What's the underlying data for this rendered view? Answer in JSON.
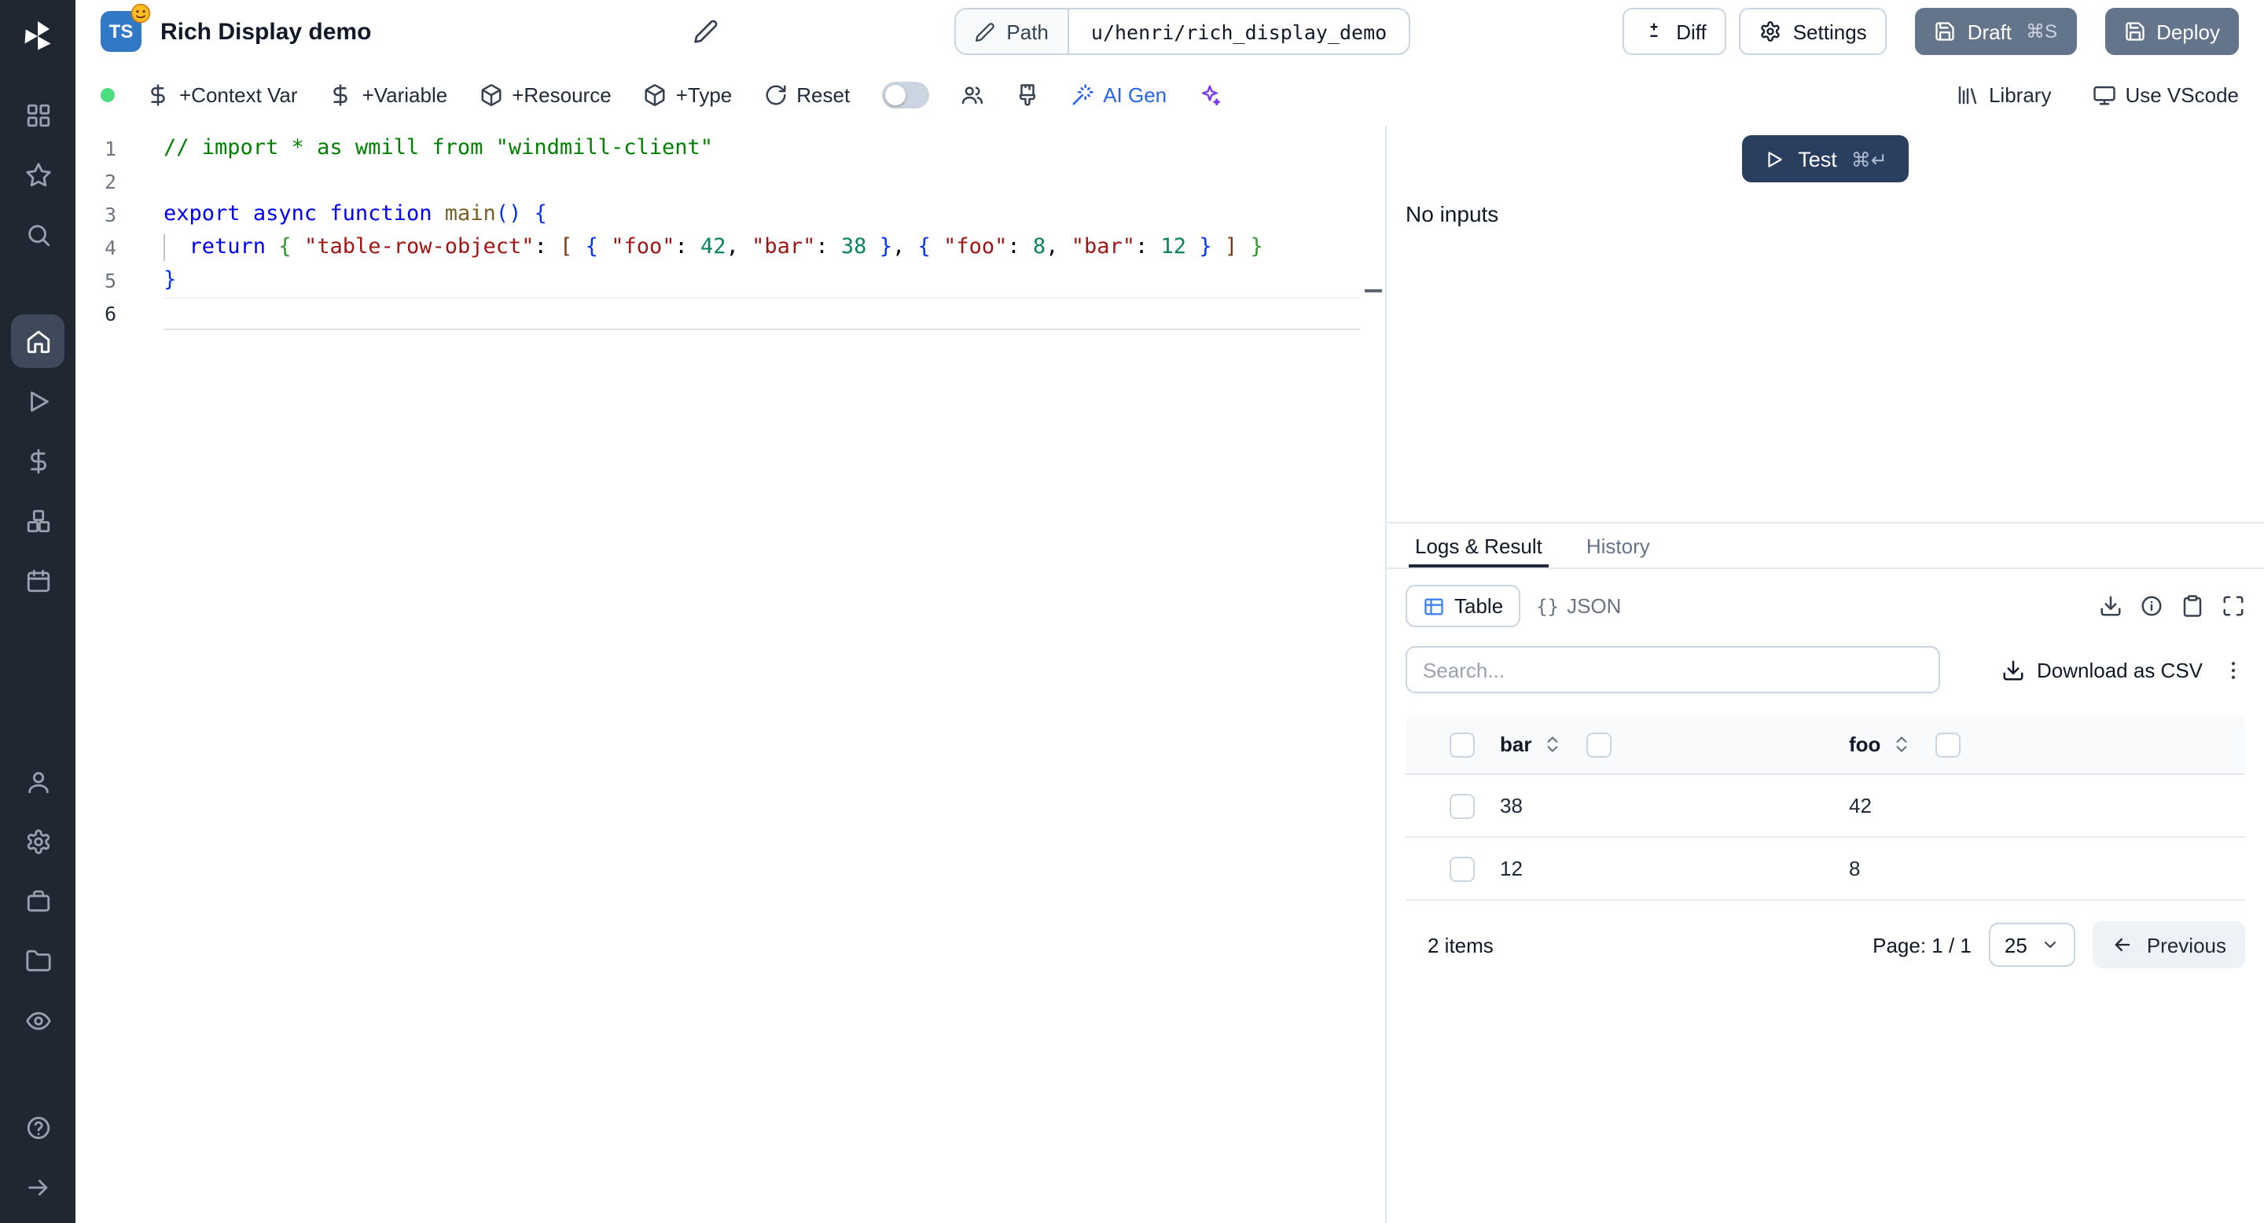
{
  "header": {
    "badge": "TS",
    "title": "Rich Display demo",
    "path_label": "Path",
    "path_value": "u/henri/rich_display_demo",
    "diff": "Diff",
    "settings": "Settings",
    "draft": "Draft",
    "draft_shortcut": "⌘S",
    "deploy": "Deploy"
  },
  "toolbar": {
    "context_var": "+Context Var",
    "variable": "+Variable",
    "resource": "+Resource",
    "type": "+Type",
    "reset": "Reset",
    "ai_gen": "AI Gen",
    "library": "Library",
    "use_vscode": "Use VScode"
  },
  "editor": {
    "lines": [
      {
        "num": "1",
        "seg": [
          {
            "t": "// import * as wmill from \"windmill-client\"",
            "c": "cm"
          }
        ]
      },
      {
        "num": "2",
        "seg": []
      },
      {
        "num": "3",
        "seg": [
          {
            "t": "export",
            "c": "kw"
          },
          {
            "t": " "
          },
          {
            "t": "async",
            "c": "kw"
          },
          {
            "t": " "
          },
          {
            "t": "function",
            "c": "kw"
          },
          {
            "t": " "
          },
          {
            "t": "main",
            "c": "fn"
          },
          {
            "t": "(",
            "c": "b1"
          },
          {
            "t": ")",
            "c": "b1"
          },
          {
            "t": " "
          },
          {
            "t": "{",
            "c": "b1"
          }
        ]
      },
      {
        "num": "4",
        "guide": true,
        "seg": [
          {
            "t": "  "
          },
          {
            "t": "return",
            "c": "kw"
          },
          {
            "t": " "
          },
          {
            "t": "{",
            "c": "b2"
          },
          {
            "t": " "
          },
          {
            "t": "\"table-row-object\"",
            "c": "str"
          },
          {
            "t": ": "
          },
          {
            "t": "[",
            "c": "b3"
          },
          {
            "t": " "
          },
          {
            "t": "{",
            "c": "b1"
          },
          {
            "t": " "
          },
          {
            "t": "\"foo\"",
            "c": "str"
          },
          {
            "t": ": "
          },
          {
            "t": "42",
            "c": "num"
          },
          {
            "t": ", "
          },
          {
            "t": "\"bar\"",
            "c": "str"
          },
          {
            "t": ": "
          },
          {
            "t": "38",
            "c": "num"
          },
          {
            "t": " "
          },
          {
            "t": "}",
            "c": "b1"
          },
          {
            "t": ", "
          },
          {
            "t": "{",
            "c": "b1"
          },
          {
            "t": " "
          },
          {
            "t": "\"foo\"",
            "c": "str"
          },
          {
            "t": ": "
          },
          {
            "t": "8",
            "c": "num"
          },
          {
            "t": ", "
          },
          {
            "t": "\"bar\"",
            "c": "str"
          },
          {
            "t": ": "
          },
          {
            "t": "12",
            "c": "num"
          },
          {
            "t": " "
          },
          {
            "t": "}",
            "c": "b1"
          },
          {
            "t": " "
          },
          {
            "t": "]",
            "c": "b3"
          },
          {
            "t": " "
          },
          {
            "t": "}",
            "c": "b2"
          }
        ]
      },
      {
        "num": "5",
        "seg": [
          {
            "t": "}",
            "c": "b1"
          }
        ]
      },
      {
        "num": "6",
        "cur": true,
        "seg": []
      }
    ]
  },
  "run_panel": {
    "test": "Test",
    "shortcut": "⌘↵",
    "no_inputs": "No inputs"
  },
  "result_panel": {
    "tab_logs": "Logs & Result",
    "tab_history": "History",
    "view_table": "Table",
    "view_json": "JSON",
    "json_prefix": "{}",
    "search_placeholder": "Search...",
    "download_csv": "Download as CSV",
    "table": {
      "columns": [
        "bar",
        "foo"
      ],
      "rows": [
        [
          "38",
          "42"
        ],
        [
          "12",
          "8"
        ]
      ]
    },
    "footer": {
      "count": "2 items",
      "page": "Page: 1 / 1",
      "page_size": "25",
      "previous": "Previous"
    }
  }
}
